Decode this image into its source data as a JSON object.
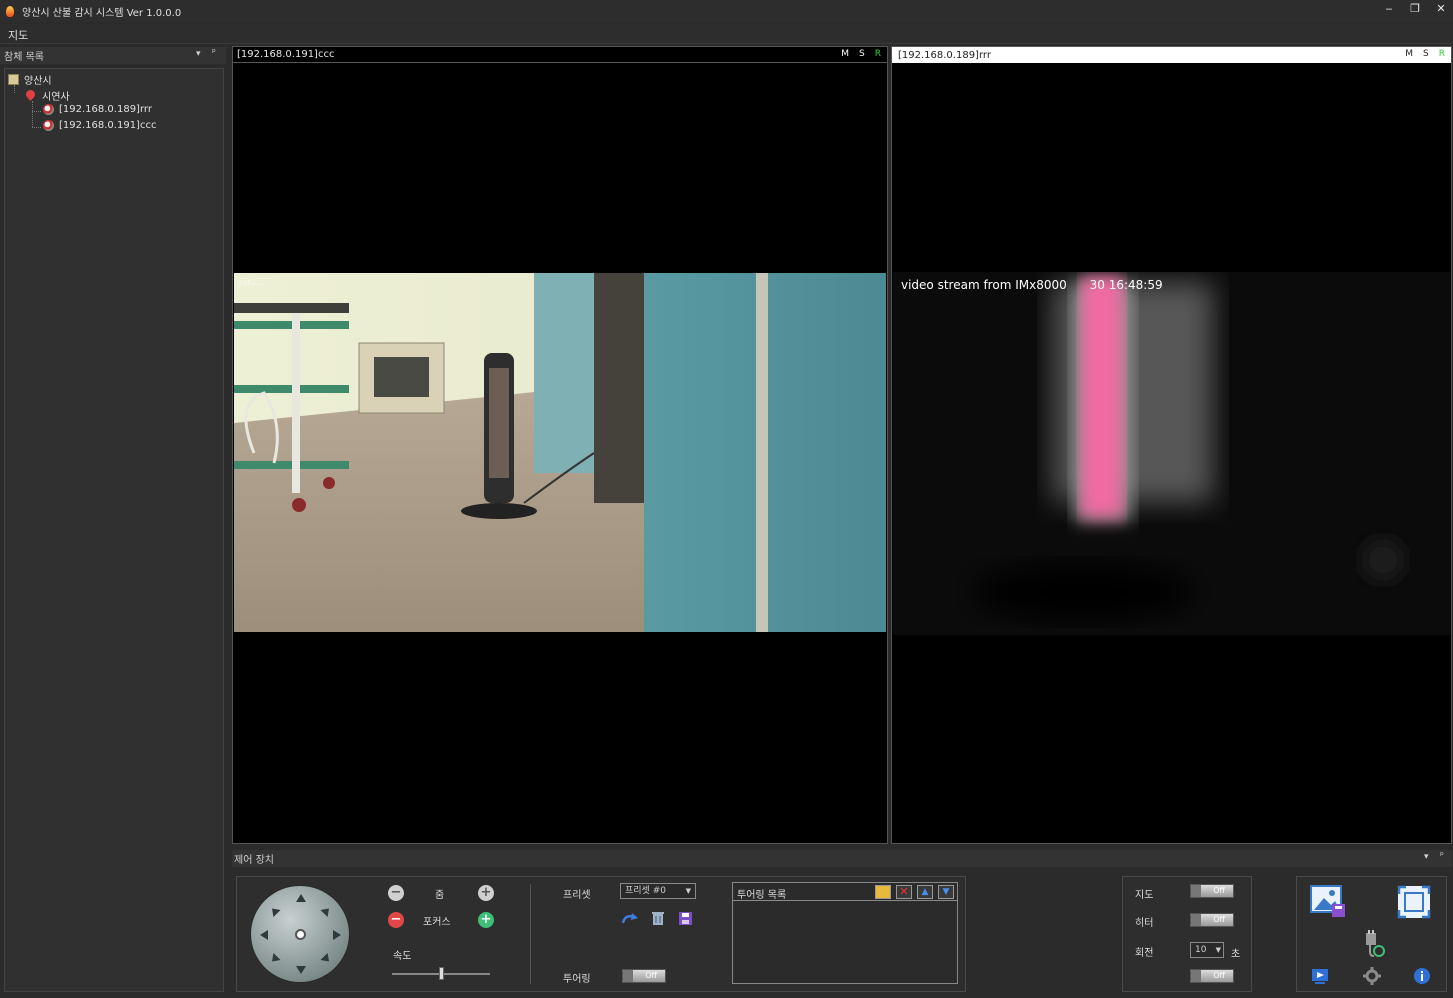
{
  "app": {
    "title": "양산시 산불 감시 시스템 Ver 1.0.0.0",
    "window_controls": [
      "‒",
      "❐",
      "✕"
    ]
  },
  "menu": {
    "items": [
      "지도"
    ]
  },
  "tree_panel": {
    "title": "참체 목록",
    "controls": [
      "▾",
      "ᵖ"
    ],
    "root": "양산시",
    "group": "시연사",
    "cameras": [
      "[192.168.0.189]rrr",
      "[192.168.0.191]ccc"
    ]
  },
  "view_left": {
    "label": "[192.168.0.191]ccc",
    "flags": [
      "M",
      "S",
      "R"
    ],
    "flag_colors": [
      "#ffffff",
      "#ffffff",
      "#2fd22f"
    ]
  },
  "view_right": {
    "label": "[192.168.0.189]rrr",
    "flags": [
      "M",
      "S",
      "R"
    ],
    "overlay_text": "video stream from IMx8000      30 16:48:59"
  },
  "control_panel": {
    "title": "제어 장치",
    "controls": [
      "▾",
      "ᵖ"
    ],
    "zoom_label": "줌",
    "focus_label": "포커스",
    "speed_label": "속도",
    "speed_value": 0.5,
    "preset_label": "프리셋",
    "preset_value": "프리셋 #0",
    "touring_label": "투어링",
    "touring_toggle": "Off",
    "touring_list_title": "투어링 목록",
    "map_label": "지도",
    "map_toggle": "Off",
    "heater_label": "히터",
    "heater_toggle": "Off",
    "rotate_label": "회전",
    "rotate_value": "10",
    "rotate_unit": "초",
    "rotate_toggle": "Off"
  },
  "colors": {
    "background": "#2b2b2b",
    "minus_button": "#e04848",
    "plus_button": "#3fbf7a",
    "gray_button": "#cfcfcf"
  }
}
